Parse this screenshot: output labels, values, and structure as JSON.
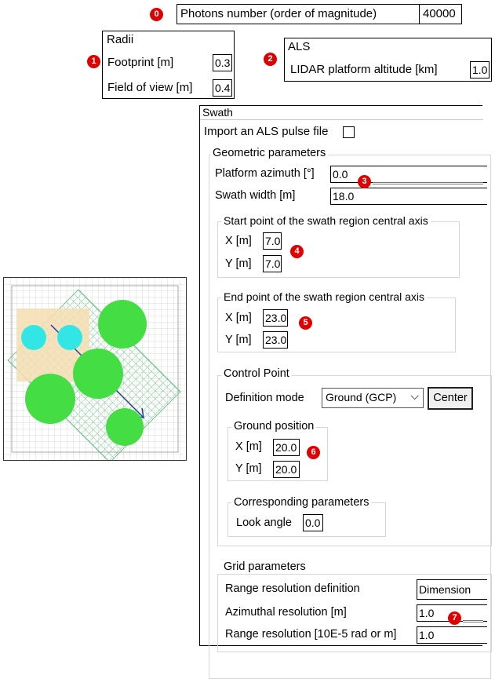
{
  "badges": [
    "0",
    "1",
    "2",
    "3",
    "4",
    "5",
    "6",
    "7"
  ],
  "photons": {
    "label": "Photons number (order of magnitude)",
    "value": "40000"
  },
  "radii": {
    "title": "Radii",
    "footprint_label": "Footprint [m]",
    "footprint_value": "0.3",
    "fov_label": "Field of view [m]",
    "fov_value": "0.4"
  },
  "als": {
    "title": "ALS",
    "altitude_label": "LIDAR platform altitude [km]",
    "altitude_value": "1.0"
  },
  "swath": {
    "title": "Swath",
    "import_label": "Import an ALS pulse file",
    "import_checked": false,
    "geometric": {
      "title": "Geometric parameters",
      "azimuth_label": "Platform azimuth [°]",
      "azimuth_value": "0.0",
      "width_label": "Swath width [m]",
      "width_value": "18.0"
    },
    "start": {
      "title": "Start point of the swath region central axis",
      "x_label": "X [m]",
      "x_value": "7.0",
      "y_label": "Y [m]",
      "y_value": "7.0"
    },
    "end": {
      "title": "End point of the swath region central axis",
      "x_label": "X [m]",
      "x_value": "23.0",
      "y_label": "Y [m]",
      "y_value": "23.0"
    },
    "control": {
      "title": "Control Point",
      "mode_label": "Definition mode",
      "mode_value": "Ground (GCP)",
      "mode_arrow": "⌵",
      "center_button": "Center",
      "ground": {
        "title": "Ground position",
        "x_label": "X [m]",
        "x_value": "20.0",
        "y_label": "Y [m]",
        "y_value": "20.0"
      },
      "corresponding": {
        "title": "Corresponding parameters",
        "look_label": "Look angle",
        "look_value": "0.0"
      }
    },
    "grid": {
      "title": "Grid parameters",
      "range_def_label": "Range resolution definition",
      "range_def_value": "Dimension",
      "azimuthal_label": "Azimuthal resolution [m]",
      "azimuthal_value": "1.0",
      "range_label": "Range resolution [10E-5 rad or m]",
      "range_value": "1.0"
    }
  },
  "scene": {
    "tree_color": "#44dd44",
    "cyan_color": "#33e6e6",
    "footprint_color": "#f5deb3",
    "grid_color": "#55bb77",
    "arrow_color": "#1f3f9f"
  }
}
